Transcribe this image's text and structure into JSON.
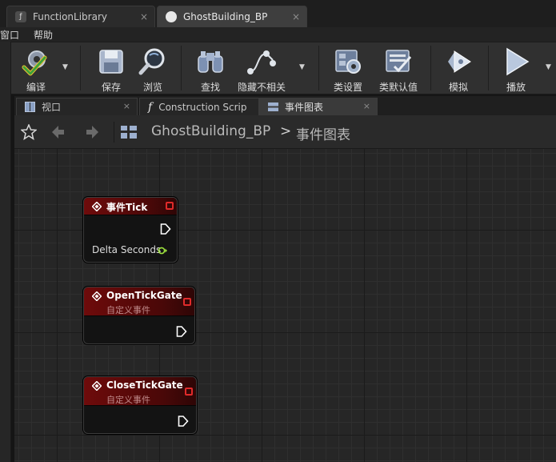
{
  "doc_tabs": [
    {
      "label": "FunctionLibrary",
      "close": "×"
    },
    {
      "label": "GhostBuilding_BP",
      "close": "×"
    }
  ],
  "menu": {
    "window": "窗口",
    "help": "帮助"
  },
  "toolbar": {
    "compile": "编译",
    "save": "保存",
    "browse": "浏览",
    "find": "查找",
    "hide_unrelated": "隐藏不相关",
    "class_settings": "类设置",
    "class_defaults": "类默认值",
    "simulate": "模拟",
    "play": "播放"
  },
  "panel_tabs": [
    {
      "label": "视口",
      "close": "×"
    },
    {
      "label": "Construction Scrip",
      "close": "×"
    },
    {
      "label": "事件图表",
      "close": "×"
    }
  ],
  "breadcrumb": {
    "blueprint": "GhostBuilding_BP",
    "separator": ">",
    "graph": "事件图表"
  },
  "nodes": [
    {
      "title": "事件Tick",
      "pin_label": "Delta Seconds"
    },
    {
      "title": "OpenTickGate",
      "subtitle": "自定义事件"
    },
    {
      "title": "CloseTickGate",
      "subtitle": "自定义事件"
    }
  ],
  "colors": {
    "event_header": "#6e0b0b",
    "delegate_pin": "#e02a2a",
    "float_pin": "#9ee33d"
  }
}
